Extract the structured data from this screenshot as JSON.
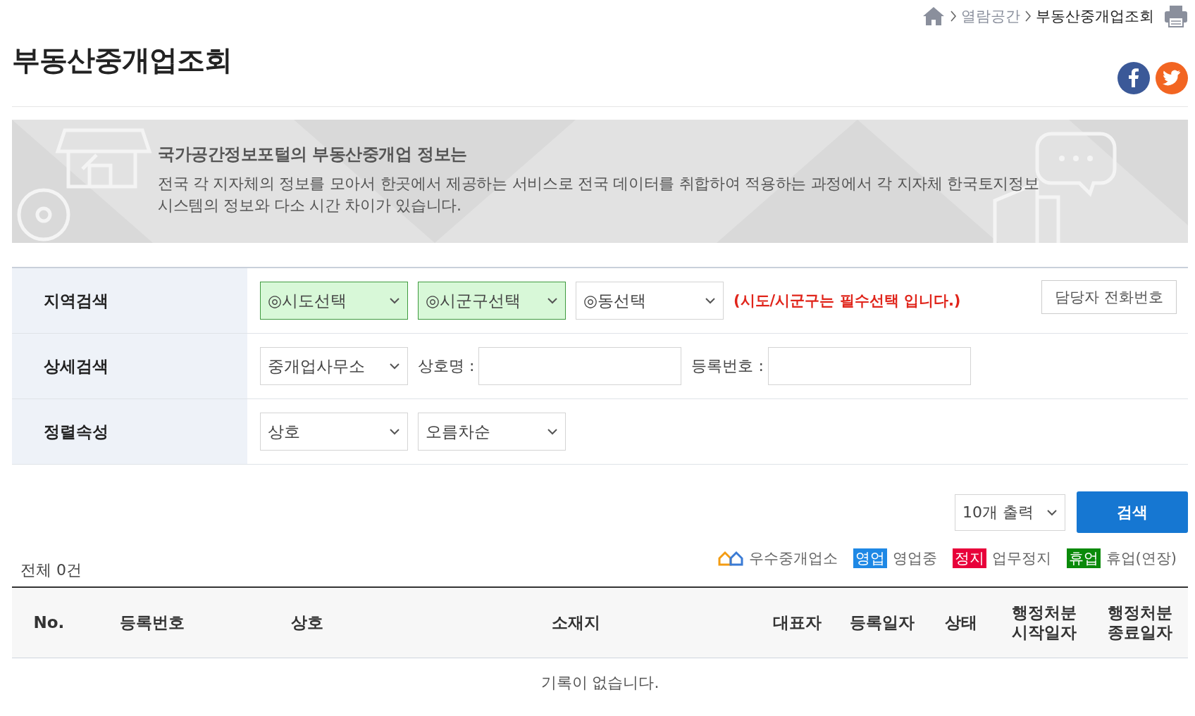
{
  "breadcrumb": [
    {
      "label": "열람공간",
      "current": false
    },
    {
      "label": "부동산중개업조회",
      "current": true
    }
  ],
  "title": "부동산중개업조회",
  "banner": {
    "heading": "국가공간정보포털의 부동산중개업 정보는",
    "body": "전국 각 지자체의 정보를 모아서 한곳에서 제공하는 서비스로 전국 데이터를 취합하여 적용하는 과정에서 각 지자체 한국토지정보시스템의 정보와 다소 시간 차이가 있습니다."
  },
  "search_rows": [
    {
      "label": "지역검색",
      "fields": [
        {
          "kind": "select",
          "value": "◎시도선택",
          "required": true
        },
        {
          "kind": "select",
          "value": "◎시군구선택",
          "required": true
        },
        {
          "kind": "select",
          "value": "◎동선택",
          "required": false
        },
        {
          "kind": "note",
          "text": "(시도/시군구는 필수선택 입니다.)"
        },
        {
          "kind": "button",
          "text": "담당자 전화번호"
        }
      ]
    },
    {
      "label": "상세검색",
      "fields": [
        {
          "kind": "select",
          "value": "중개업사무소",
          "required": false
        },
        {
          "kind": "label",
          "text": "상호명 :"
        },
        {
          "kind": "input"
        },
        {
          "kind": "label",
          "text": "등록번호 :"
        },
        {
          "kind": "input"
        }
      ]
    },
    {
      "label": "정렬속성",
      "fields": [
        {
          "kind": "select",
          "value": "상호",
          "required": false
        },
        {
          "kind": "select",
          "value": "오름차순",
          "required": false
        }
      ]
    }
  ],
  "page_size": "10개 출력",
  "search_button": "검색",
  "total": "전체 0건",
  "legend": [
    {
      "kind": "logo",
      "label": "우수중개업소"
    },
    {
      "kind": "badge",
      "badge": "영업",
      "label": "영업중",
      "color": "#1e88e5"
    },
    {
      "kind": "badge",
      "badge": "정지",
      "label": "업무정지",
      "color": "#e8003a"
    },
    {
      "kind": "badge",
      "badge": "휴업",
      "label": "휴업(연장)",
      "color": "#0a8a0a"
    }
  ],
  "table": {
    "columns": [
      "No.",
      "등록번호",
      "상호",
      "소재지",
      "대표자",
      "등록일자",
      "상태",
      "행정처분 시작일자",
      "행정처분 종료일자"
    ],
    "empty_message": "기록이 없습니다."
  }
}
